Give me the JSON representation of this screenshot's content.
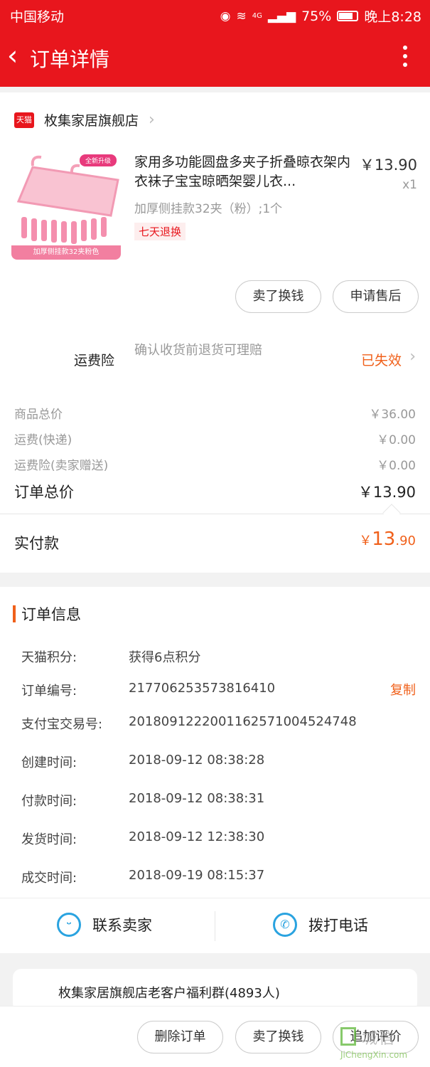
{
  "status_bar": {
    "carrier": "中国移动",
    "network": "4G",
    "battery": "75%",
    "time": "晚上8:28"
  },
  "header": {
    "title": "订单详情"
  },
  "store": {
    "logo_text": "天猫",
    "name": "枚集家居旗舰店"
  },
  "product": {
    "badge": "全新升级",
    "caption": "加厚侧挂款32夹粉色",
    "title": "家用多功能圆盘多夹子折叠晾衣架内衣袜子宝宝晾晒架婴儿衣...",
    "price": "￥13.90",
    "qty": "x1",
    "spec": "加厚侧挂款32夹（粉）;1个",
    "tag": "七天退换"
  },
  "item_buttons": {
    "sell": "卖了换钱",
    "after_sale": "申请售后"
  },
  "insurance": {
    "label": "运费险",
    "desc": "确认收货前退货可理赔",
    "status": "已失效"
  },
  "prices": [
    {
      "label": "商品总价",
      "value": "￥36.00"
    },
    {
      "label": "运费(快递)",
      "value": "￥0.00"
    },
    {
      "label": "运费险(卖家赠送)",
      "value": "￥0.00"
    }
  ],
  "order_total": {
    "label": "订单总价",
    "value": "￥13.90"
  },
  "paid": {
    "label": "实付款",
    "symbol": "￥",
    "int": "13",
    "dec": ".90"
  },
  "order_info": {
    "title": "订单信息",
    "copy_label": "复制",
    "rows": [
      {
        "label": "天猫积分:",
        "value": "获得6点积分"
      },
      {
        "label": "订单编号:",
        "value": "217706253573816410"
      },
      {
        "label": "支付宝交易号:",
        "value": "2018091222001162571004524748"
      },
      {
        "label": "创建时间:",
        "value": "2018-09-12 08:38:28"
      },
      {
        "label": "付款时间:",
        "value": "2018-09-12 08:38:31"
      },
      {
        "label": "发货时间:",
        "value": "2018-09-12 12:38:30"
      },
      {
        "label": "成交时间:",
        "value": "2018-09-19 08:15:37"
      }
    ]
  },
  "contact": {
    "seller": "联系卖家",
    "phone": "拨打电话"
  },
  "group": {
    "text": "枚集家居旗舰店老客户福利群(4893人)"
  },
  "bottom_buttons": {
    "delete": "删除订单",
    "sell": "卖了换钱",
    "review": "追加评价"
  },
  "watermark": {
    "cn": "城信",
    "en": "JiChengXin.com"
  },
  "colors": {
    "brand_red": "#e8161d",
    "accent_orange": "#f0601a",
    "icon_blue": "#2aa3e0"
  }
}
